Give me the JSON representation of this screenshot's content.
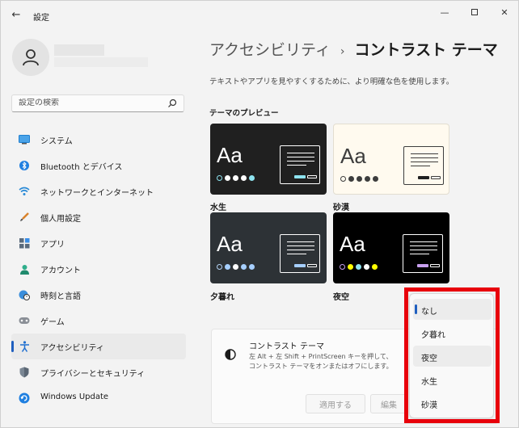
{
  "app": {
    "title": "設定",
    "back_glyph": "←"
  },
  "window_controls": {
    "minimize": "—",
    "close": "✕"
  },
  "search": {
    "placeholder": "設定の検索"
  },
  "nav": [
    {
      "label": "システム",
      "icon": "monitor-icon"
    },
    {
      "label": "Bluetooth とデバイス",
      "icon": "bluetooth-icon"
    },
    {
      "label": "ネットワークとインターネット",
      "icon": "wifi-icon"
    },
    {
      "label": "個人用設定",
      "icon": "brush-icon"
    },
    {
      "label": "アプリ",
      "icon": "apps-icon"
    },
    {
      "label": "アカウント",
      "icon": "person-icon"
    },
    {
      "label": "時刻と言語",
      "icon": "globe-clock-icon"
    },
    {
      "label": "ゲーム",
      "icon": "gamepad-icon"
    },
    {
      "label": "アクセシビリティ",
      "icon": "accessibility-icon",
      "active": true
    },
    {
      "label": "プライバシーとセキュリティ",
      "icon": "shield-icon"
    },
    {
      "label": "Windows Update",
      "icon": "update-icon"
    }
  ],
  "breadcrumb": {
    "parent": "アクセシビリティ",
    "separator": "›",
    "current": "コントラスト テーマ"
  },
  "description": "テキストやアプリを見やすくするために、より明確な色を使用します。",
  "preview_heading": "テーマのプレビュー",
  "themes": [
    {
      "name": "水生",
      "aa": "Aa",
      "bg": "#202020",
      "fg": "#ffffff",
      "win_border": "#ffffff",
      "btn": "#8ee3f0",
      "dots": [
        "#8ee3f0",
        "#ffffff",
        "#ffffff",
        "#ffffff",
        "#8ee3f0"
      ]
    },
    {
      "name": "砂漠",
      "aa": "Aa",
      "bg": "#fffaef",
      "fg": "#3d3d3d",
      "win_border": "#3d3d3d",
      "btn": "#202020",
      "dots": [
        "#3d3d3d",
        "#3d3d3d",
        "#3d3d3d",
        "#3d3d3d",
        "#3d3d3d"
      ]
    },
    {
      "name": "夕暮れ",
      "aa": "Aa",
      "bg": "#2d3236",
      "fg": "#ffffff",
      "win_border": "#ffffff",
      "btn": "#a6cfff",
      "dots": [
        "#b4d3f6",
        "#a6cfff",
        "#ffffff",
        "#a6cfff",
        "#a6cfff"
      ]
    },
    {
      "name": "夜空",
      "aa": "Aa",
      "bg": "#000000",
      "fg": "#ffffff",
      "win_border": "#ffffff",
      "btn": "#c8a0f0",
      "dots": [
        "#c8a0f0",
        "#ffff00",
        "#8ee3f0",
        "#ffffff",
        "#ffff00"
      ]
    }
  ],
  "setting": {
    "title": "コントラスト テーマ",
    "desc_line1": "左 Alt + 左 Shift + PrintScreen キーを押して、",
    "desc_line2": "コントラスト テーマをオンまたはオフにします。",
    "apply_label": "適用する",
    "edit_label": "編集"
  },
  "dropdown": {
    "options": [
      "なし",
      "夕暮れ",
      "夜空",
      "水生",
      "砂漠"
    ],
    "selected": "なし"
  },
  "colors": {
    "accent": "#1f5fbf",
    "highlight": "#e8000b"
  }
}
